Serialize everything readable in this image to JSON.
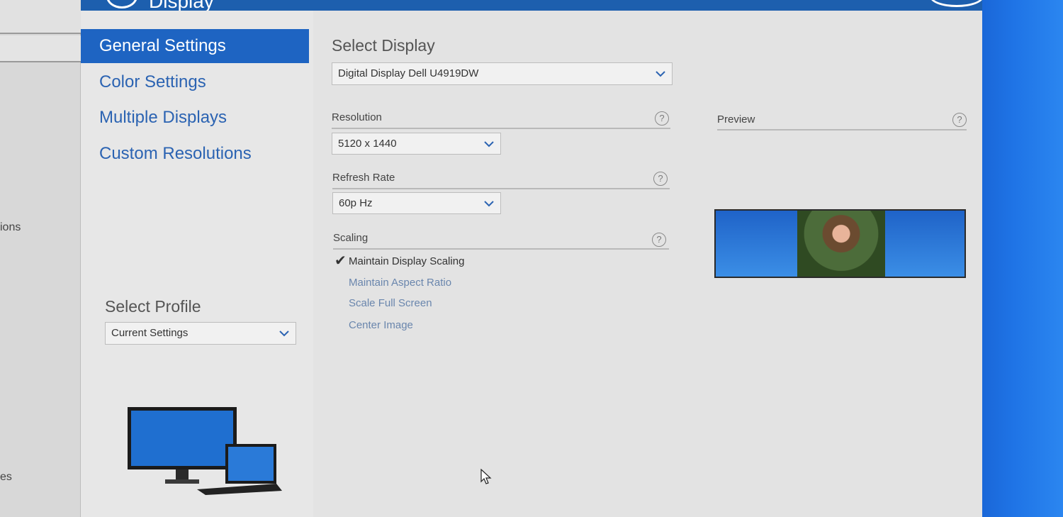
{
  "left_strip": {
    "fragments": [
      "ions",
      "es"
    ]
  },
  "header": {
    "title": "Display"
  },
  "sidebar": {
    "items": [
      {
        "label": "General Settings",
        "active": true
      },
      {
        "label": "Color Settings",
        "active": false
      },
      {
        "label": "Multiple Displays",
        "active": false
      },
      {
        "label": "Custom Resolutions",
        "active": false
      }
    ],
    "profile": {
      "label": "Select Profile",
      "value": "Current Settings"
    }
  },
  "main": {
    "select_display": {
      "label": "Select Display",
      "value": "Digital Display Dell U4919DW"
    },
    "resolution": {
      "label": "Resolution",
      "value": "5120 x 1440",
      "help": "?"
    },
    "refresh_rate": {
      "label": "Refresh Rate",
      "value": "60p Hz",
      "help": "?"
    },
    "scaling": {
      "label": "Scaling",
      "help": "?",
      "options": [
        {
          "label": "Maintain Display Scaling",
          "selected": true
        },
        {
          "label": "Maintain Aspect Ratio",
          "selected": false
        },
        {
          "label": "Scale Full Screen",
          "selected": false
        },
        {
          "label": "Center Image",
          "selected": false
        }
      ]
    },
    "preview": {
      "label": "Preview",
      "help": "?"
    }
  },
  "colors": {
    "accent": "#1e64c2",
    "header": "#1d5fae",
    "link": "#2b63b2"
  },
  "icons": {
    "help": "help-icon",
    "dropdown": "chevron-down-icon",
    "check": "checkmark-icon"
  }
}
